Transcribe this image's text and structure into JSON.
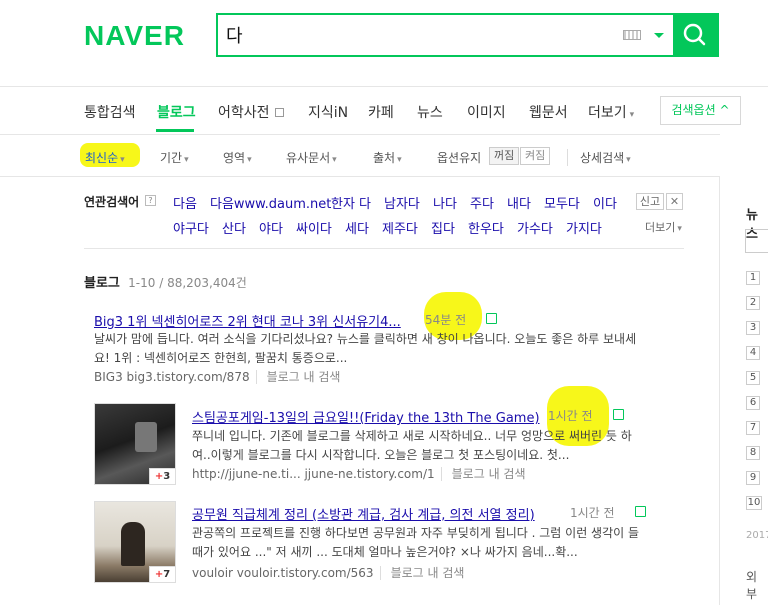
{
  "header": {
    "logo": "NAVER",
    "search_value": "다",
    "icons": {
      "keyboard": "keyboard-icon",
      "dropdown": "chevron-down-icon",
      "search": "search-icon"
    },
    "brand_color": "#03c75a"
  },
  "tabs": [
    "통합검색",
    "블로그",
    "어학사전",
    "지식iN",
    "카페",
    "뉴스",
    "이미지",
    "웹문서",
    "더보기"
  ],
  "active_tab": "블로그",
  "search_options_label": "검색옵션",
  "filters": {
    "sort": "최신순",
    "period": "기간",
    "area": "영역",
    "similar": "유사문서",
    "source": "출처",
    "keep_option": "옵션유지",
    "keep_off": "꺼짐",
    "keep_on": "켜짐",
    "detail": "상세검색"
  },
  "related": {
    "title": "연관검색어",
    "help": "?",
    "row1": [
      "다음",
      "다음www.daum.net",
      "한자 다",
      "남자다",
      "나다",
      "주다",
      "내다",
      "모두다",
      "이다"
    ],
    "row2": [
      "야구다",
      "산다",
      "야다",
      "싸이다",
      "세다",
      "제주다",
      "집다",
      "한우다",
      "가수다",
      "가지다"
    ],
    "report": "신고",
    "close": "✕",
    "more": "더보기"
  },
  "results_header": {
    "title": "블로그",
    "range": "1-10 / 88,203,404건"
  },
  "results": [
    {
      "title": "Big3 1위 넥센히어로즈 2위 현대 코나 3위 신서유기4...",
      "time": "54분 전",
      "desc_line1": "날씨가 맘에 듭니다. 여러 소식을 기다리셨나요? 뉴스를 클릭하면 새 창이 나옵니다. 오늘도 좋은 하루 보내세",
      "desc_line2": "요! 1위 : 넥센히어로즈 한현희, 팔꿈치 통증으로...",
      "site": "BIG3  big3.tistory.com/878",
      "inblog": "블로그 내 검색"
    },
    {
      "title": "스팀공포게임-13일의 금요일!!(Friday the 13th The Game)",
      "time": "1시간 전",
      "desc_line1": "쭈니네 입니다. 기존에 블로그를 삭제하고 새로 시작하네요.. 너무 엉망으로 써버린 듯 하",
      "desc_line2": "여..이렇게 블로그를 다시 시작합니다. 오늘은 블로그 첫 포스팅이네요. 첫...",
      "site": "http://jjune-ne.ti...  jjune-ne.tistory.com/1",
      "inblog": "블로그 내 검색",
      "thumb_count": "3"
    },
    {
      "title": "공무원 직급체계 정리 (소방관 계급, 검사 계급, 의전 서열 정리)",
      "time": "1시간 전",
      "desc_line1": "관공쪽의 프로젝트를 진행 하다보면 공무원과 자주 부딪히게 됩니다 . 그럼 이런 생각이 들",
      "desc_line2": "때가 있어요 ...\" 저 새끼 ... 도대체 얼마나 높은거야? ×나 싸가지 음네...확...",
      "site": "vouloir  vouloir.tistory.com/563",
      "inblog": "블로그 내 검색",
      "thumb_count": "7"
    }
  ],
  "sidebar": {
    "title": "뉴스",
    "ranks": [
      "1",
      "2",
      "3",
      "4",
      "5",
      "6",
      "7",
      "8",
      "9",
      "10"
    ],
    "year": "2017",
    "ext": "외부"
  },
  "highlight_color": "#f7f71a"
}
